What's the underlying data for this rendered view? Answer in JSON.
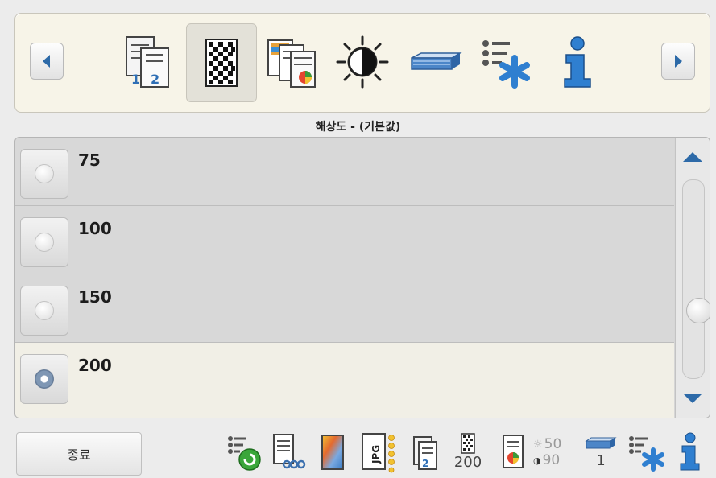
{
  "toolbar": {
    "left_arrow": "chevron-left",
    "right_arrow": "chevron-right",
    "tools": [
      {
        "icon": "two-sided-document-icon"
      },
      {
        "icon": "resolution-grid-icon",
        "active": true
      },
      {
        "icon": "color-documents-icon"
      },
      {
        "icon": "brightness-contrast-icon"
      },
      {
        "icon": "paper-stack-icon"
      },
      {
        "icon": "advanced-settings-icon"
      },
      {
        "icon": "info-icon"
      }
    ]
  },
  "section": {
    "title": "해상도 - (기본값)"
  },
  "list": {
    "items": [
      {
        "label": "75",
        "selected": false
      },
      {
        "label": "100",
        "selected": false
      },
      {
        "label": "150",
        "selected": false
      },
      {
        "label": "200",
        "selected": true
      }
    ]
  },
  "footer": {
    "close_label": "종료",
    "status": {
      "resolution_value": "200",
      "brightness_value": "50",
      "contrast_value": "90",
      "pages_value": "1"
    }
  },
  "colors": {
    "accent_blue": "#2f6fb5",
    "selected_row": "#f1efe6",
    "panel_bg": "#f7f4e8"
  }
}
